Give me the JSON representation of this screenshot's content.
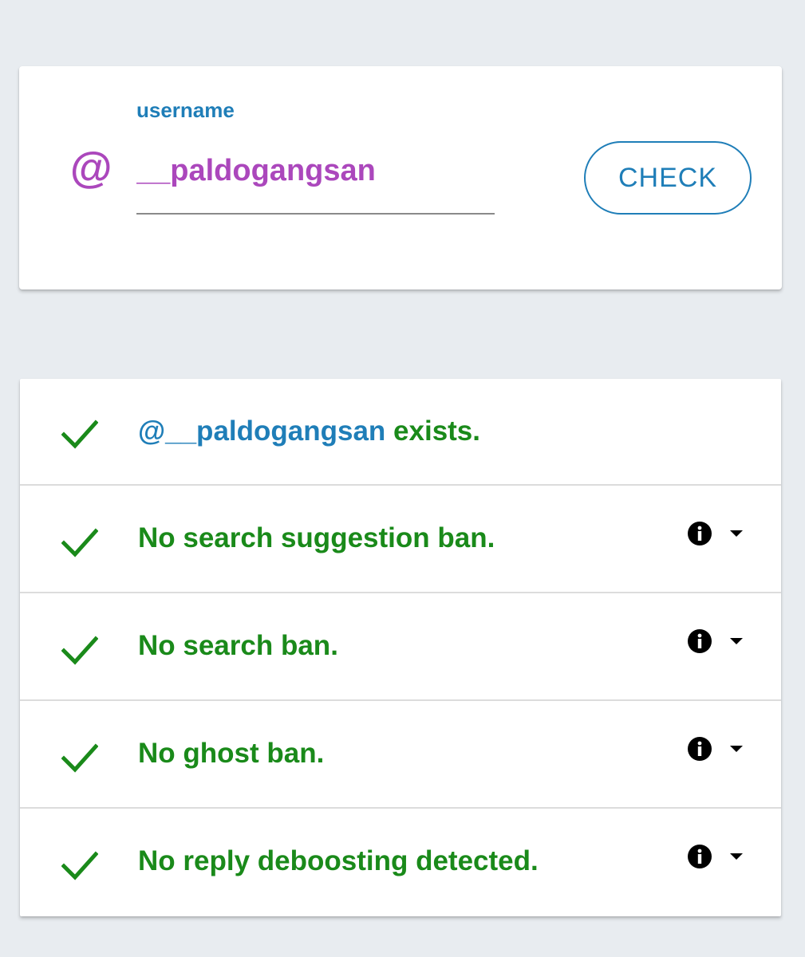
{
  "search": {
    "at_symbol": "@",
    "label": "username",
    "value": "__paldogangsan",
    "button_label": "CHECK"
  },
  "results": [
    {
      "prefix": "@__paldogangsan",
      "text": " exists.",
      "has_info": false,
      "icon": "check-icon",
      "status": "ok"
    },
    {
      "prefix": "",
      "text": "No search suggestion ban.",
      "has_info": true,
      "icon": "check-icon",
      "status": "ok"
    },
    {
      "prefix": "",
      "text": "No search ban.",
      "has_info": true,
      "icon": "check-icon",
      "status": "ok"
    },
    {
      "prefix": "",
      "text": "No ghost ban.",
      "has_info": true,
      "icon": "check-icon",
      "status": "ok"
    },
    {
      "prefix": "",
      "text": "No reply deboosting detected.",
      "has_info": true,
      "icon": "check-icon",
      "status": "ok"
    }
  ],
  "colors": {
    "background": "#e8ecf0",
    "accent_blue": "#1f7eb8",
    "accent_purple": "#ab47bc",
    "success_green": "#1a8a1a"
  }
}
